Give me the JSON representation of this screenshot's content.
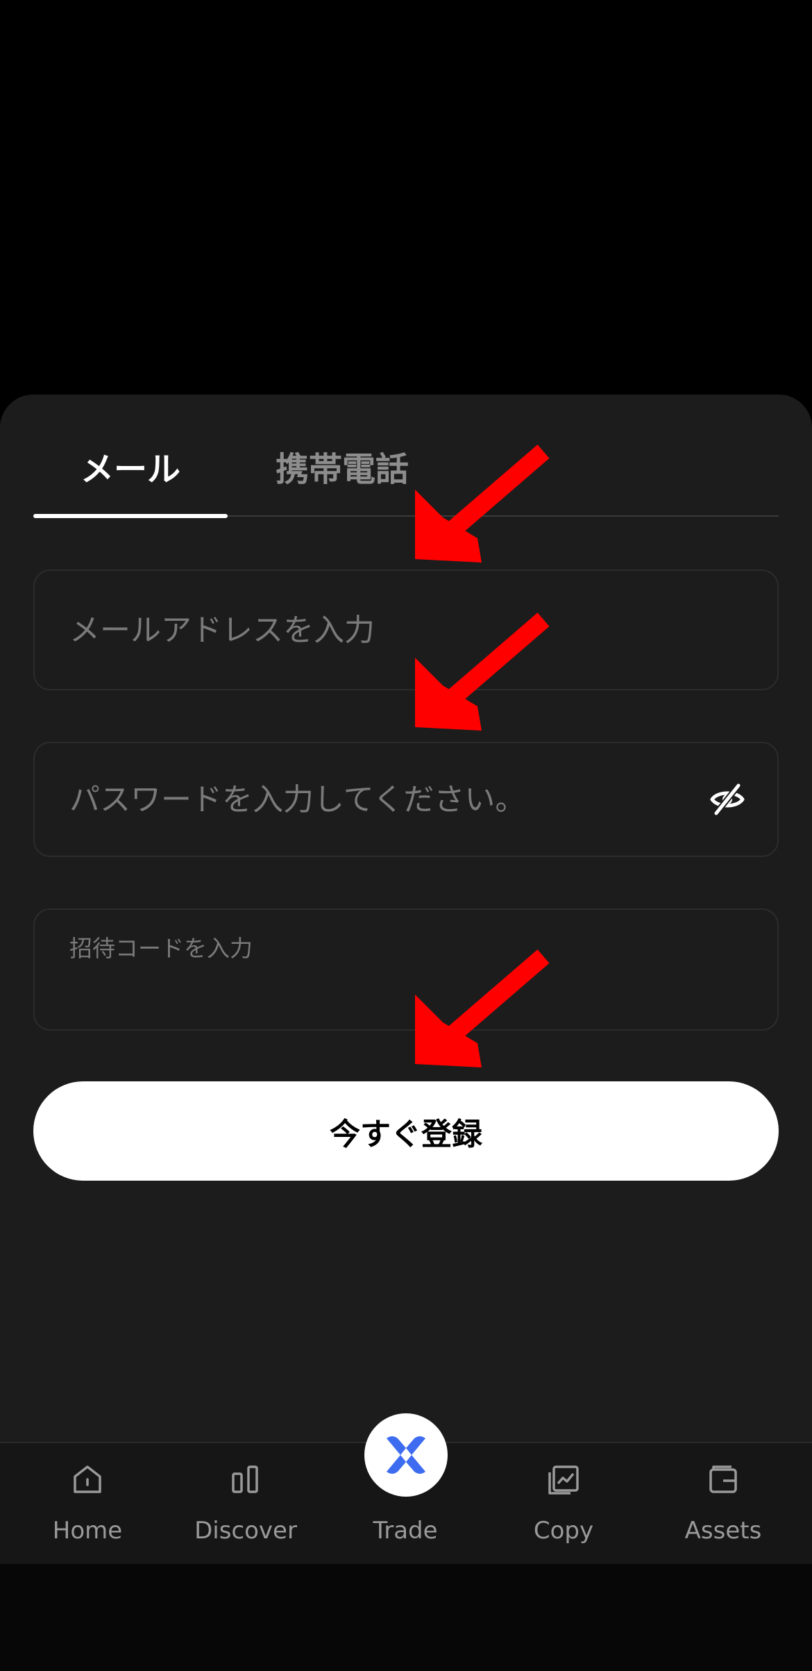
{
  "tabs": [
    {
      "label": "メール",
      "active": true
    },
    {
      "label": "携帯電話",
      "active": false
    }
  ],
  "form": {
    "email_placeholder": "メールアドレスを入力",
    "password_placeholder": "パスワードを入力してください。",
    "invite_placeholder": "招待コードを入力",
    "submit_label": "今すぐ登録"
  },
  "nav": {
    "items": [
      {
        "label": "Home",
        "icon": "home-icon"
      },
      {
        "label": "Discover",
        "icon": "discover-icon"
      },
      {
        "label": "Trade",
        "icon": "trade-logo-icon"
      },
      {
        "label": "Copy",
        "icon": "copy-trading-icon"
      },
      {
        "label": "Assets",
        "icon": "wallet-icon"
      }
    ]
  },
  "colors": {
    "background": "#000000",
    "sheet": "#1c1c1c",
    "accent_blue": "#3d6cf0",
    "annotation_arrow": "#ff0000"
  }
}
